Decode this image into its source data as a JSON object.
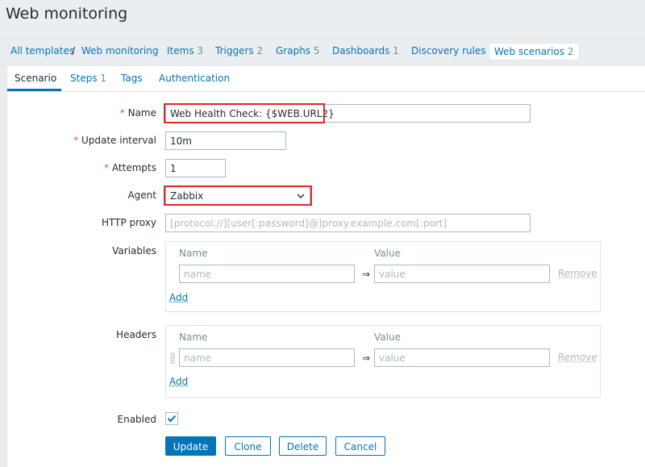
{
  "page": {
    "title": "Web monitoring"
  },
  "breadcrumbs": {
    "all_templates": "All templates",
    "separator": "/",
    "template": "Web monitoring",
    "items": {
      "label": "Items",
      "count": "3"
    },
    "triggers": {
      "label": "Triggers",
      "count": "2"
    },
    "graphs": {
      "label": "Graphs",
      "count": "5"
    },
    "dashboards": {
      "label": "Dashboards",
      "count": "1"
    },
    "discovery": {
      "label": "Discovery rules"
    },
    "web_scenarios": {
      "label": "Web scenarios",
      "count": "2"
    }
  },
  "tabs": {
    "scenario": "Scenario",
    "steps": {
      "label": "Steps",
      "count": "1"
    },
    "tags": "Tags",
    "authentication": "Authentication"
  },
  "form": {
    "required_mark": "*",
    "name": {
      "label": "Name",
      "value": "Web Health Check: {$WEB.URL2}"
    },
    "update_interval": {
      "label": "Update interval",
      "value": "10m"
    },
    "attempts": {
      "label": "Attempts",
      "value": "1"
    },
    "agent": {
      "label": "Agent",
      "value": "Zabbix"
    },
    "http_proxy": {
      "label": "HTTP proxy",
      "placeholder": "[protocol://][user[:password]@]proxy.example.com[:port]"
    },
    "variables": {
      "label": "Variables",
      "col_name": "Name",
      "col_value": "Value",
      "name_placeholder": "name",
      "value_placeholder": "value",
      "arrow": "⇒",
      "remove": "Remove",
      "add": "Add"
    },
    "headers": {
      "label": "Headers",
      "col_name": "Name",
      "col_value": "Value",
      "name_placeholder": "name",
      "value_placeholder": "value",
      "arrow": "⇒",
      "remove": "Remove",
      "add": "Add"
    },
    "enabled": {
      "label": "Enabled",
      "checked": true
    }
  },
  "buttons": {
    "update": "Update",
    "clone": "Clone",
    "delete": "Delete",
    "cancel": "Cancel"
  },
  "colors": {
    "accent": "#0275b8",
    "highlight": "#e02828",
    "required": "#e45959"
  }
}
